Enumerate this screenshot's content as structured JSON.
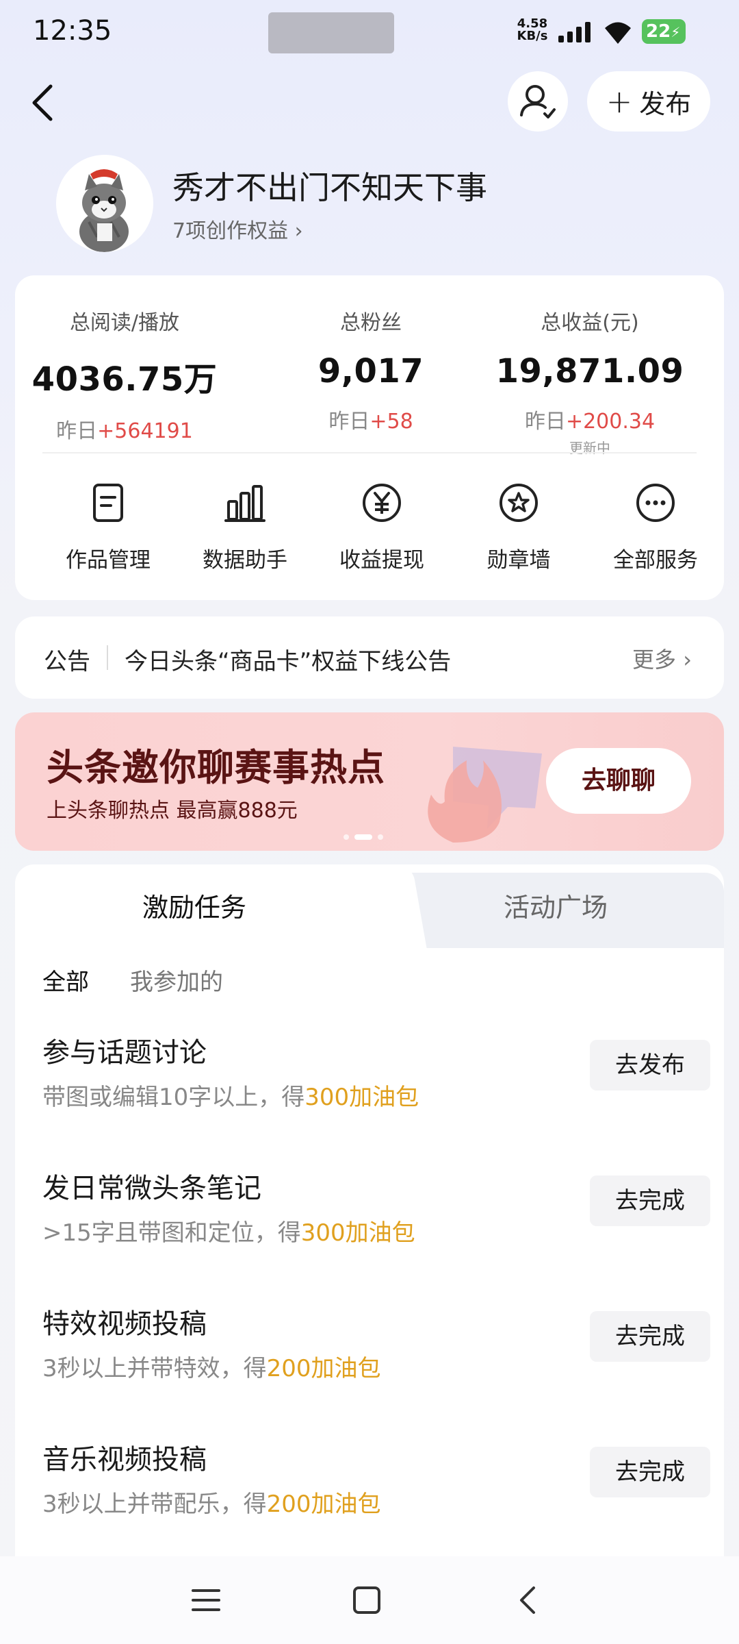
{
  "status_bar": {
    "time": "12:35",
    "net_speed_value": "4.58",
    "net_speed_unit": "KB/s",
    "battery": "22"
  },
  "header": {
    "publish_label": "发布",
    "user_name": "秀才不出门不知天下事",
    "benefits_link": "7项创作权益"
  },
  "stats": [
    {
      "label": "总阅读/播放",
      "value": "4036.75万",
      "delta_prefix": "昨日",
      "delta": "+564191"
    },
    {
      "label": "总粉丝",
      "value": "9,017",
      "delta_prefix": "昨日",
      "delta": "+58"
    },
    {
      "label": "总收益(元)",
      "value": "19,871.09",
      "delta_prefix": "昨日",
      "delta": "+200.34",
      "note": "更新中"
    }
  ],
  "services": [
    {
      "label": "作品管理",
      "icon": "document-icon"
    },
    {
      "label": "数据助手",
      "icon": "bar-chart-icon"
    },
    {
      "label": "收益提现",
      "icon": "yuan-coin-icon"
    },
    {
      "label": "勋章墙",
      "icon": "medal-icon"
    },
    {
      "label": "全部服务",
      "icon": "more-dots-icon"
    }
  ],
  "notice": {
    "tag": "公告",
    "text": "今日头条“商品卡”权益下线公告",
    "more": "更多"
  },
  "banner": {
    "title": "头条邀你聊赛事热点",
    "subtitle": "上头条聊热点 最高赢888元",
    "cta": "去聊聊"
  },
  "tabs": {
    "active": "激励任务",
    "inactive": "活动广场"
  },
  "filters": {
    "all": "全部",
    "joined": "我参加的"
  },
  "tasks": [
    {
      "title": "参与话题讨论",
      "desc_prefix": "带图或编辑10字以上，得",
      "reward": "300加油包",
      "button": "去发布"
    },
    {
      "title": "发日常微头条笔记",
      "desc_prefix": ">15字且带图和定位，得",
      "reward": "300加油包",
      "button": "去完成"
    },
    {
      "title": "特效视频投稿",
      "desc_prefix": "3秒以上并带特效，得",
      "reward": "200加油包",
      "button": "去完成"
    },
    {
      "title": "音乐视频投稿",
      "desc_prefix": "3秒以上并带配乐，得",
      "reward": "200加油包",
      "button": "去完成"
    }
  ],
  "colors": {
    "accent_red": "#e04b48",
    "reward_gold": "#e0a01e",
    "banner_bg": "#fbd2d2",
    "banner_text": "#5a1414"
  }
}
